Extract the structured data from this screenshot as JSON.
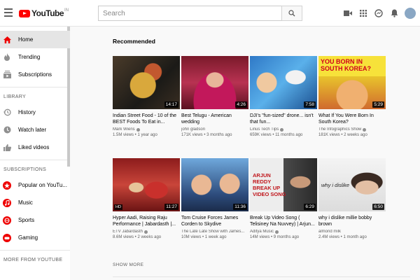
{
  "header": {
    "logo_text": "YouTube",
    "logo_sup": "IN",
    "search_placeholder": "Search"
  },
  "sidebar": {
    "main_items": [
      {
        "label": "Home",
        "icon": "home-icon"
      },
      {
        "label": "Trending",
        "icon": "flame-icon"
      },
      {
        "label": "Subscriptions",
        "icon": "subscriptions-icon"
      }
    ],
    "library_header": "LIBRARY",
    "library_items": [
      {
        "label": "History",
        "icon": "history-icon"
      },
      {
        "label": "Watch later",
        "icon": "clock-icon"
      },
      {
        "label": "Liked videos",
        "icon": "thumb-up-icon"
      }
    ],
    "subscriptions_header": "SUBSCRIPTIONS",
    "subscription_items": [
      {
        "label": "Popular on YouTu...",
        "icon": "popular-channel-icon"
      },
      {
        "label": "Music",
        "icon": "music-channel-icon"
      },
      {
        "label": "Sports",
        "icon": "sports-channel-icon"
      },
      {
        "label": "Gaming",
        "icon": "gaming-channel-icon"
      }
    ],
    "more_header": "MORE FROM YOUTUBE"
  },
  "main": {
    "section_title": "Recommended",
    "show_more": "SHOW MORE",
    "videos": [
      {
        "title": "Indian Street Food - 10 of the BEST Foods To Eat in...",
        "channel": "Mark Wiens",
        "verified": true,
        "meta": "1.5M views • 1 year ago",
        "duration": "14:17"
      },
      {
        "title": "Best Telugu - American wedding",
        "channel": "john gladson",
        "verified": false,
        "meta": "171K views • 3 months ago",
        "duration": "4:26"
      },
      {
        "title": "DJI's \"fun-sized\" drone... isn't that fun...",
        "channel": "Linus Tech Tips",
        "verified": true,
        "meta": "659K views • 11 months ago",
        "duration": "7:58"
      },
      {
        "title": "What If You Were Born In South Korea?",
        "channel": "The Infographics Show",
        "verified": true,
        "meta": "181K views • 2 weeks ago",
        "duration": "5:29",
        "thumb_text": "YOU BORN IN SOUTH KOREA?"
      },
      {
        "title": "Hyper Aadi, Raising Raju Performance | Jabardasth |...",
        "channel": "ETV Jabardasth",
        "verified": true,
        "meta": "8.6M views • 2 weeks ago",
        "duration": "11:27",
        "badge": "HD"
      },
      {
        "title": "Tom Cruise Forces James Corden to Skydive",
        "channel": "The Late Late Show with James...",
        "verified": false,
        "meta": "10M views • 1 week ago",
        "duration": "11:36"
      },
      {
        "title": "Break Up Video Song ( Telisiney Na Nuvvey) | Arjun...",
        "channel": "Aditya Music",
        "verified": true,
        "meta": "14M views • 9 months ago",
        "duration": "6:29",
        "thumb_text": "ARJUN REDDY BREAK UP VIDEO SONG"
      },
      {
        "title": "why i dislike millie bobby brown",
        "channel": "almond milk",
        "verified": false,
        "meta": "2.4M views • 1 month ago",
        "duration": "6:50",
        "thumb_text": "why i dislike"
      }
    ]
  },
  "colors": {
    "brand_red": "#ff0000",
    "sidebar_active": "#e5e5e5",
    "background": "#f9f9f9"
  }
}
